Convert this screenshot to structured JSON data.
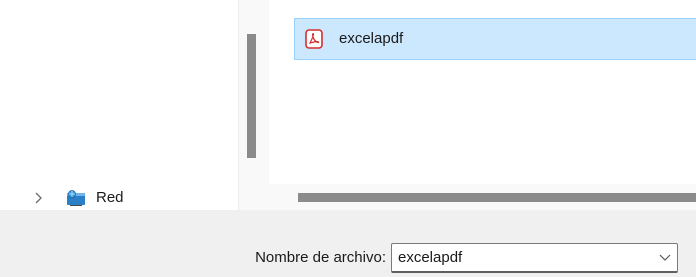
{
  "navigation": {
    "items": [
      {
        "label": "Red",
        "icon": "network-icon",
        "expanded": false
      }
    ]
  },
  "files": {
    "items": [
      {
        "name": "excelapdf",
        "icon": "pdf-icon",
        "selected": true
      }
    ]
  },
  "footer": {
    "filename_label": "Nombre de archivo:",
    "filename_value": "excelapdf"
  },
  "colors": {
    "selection_bg": "#cce8ff",
    "selection_border": "#99d1ff",
    "pdf_red": "#d32f2f",
    "footer_bg": "#f0f0f0"
  }
}
